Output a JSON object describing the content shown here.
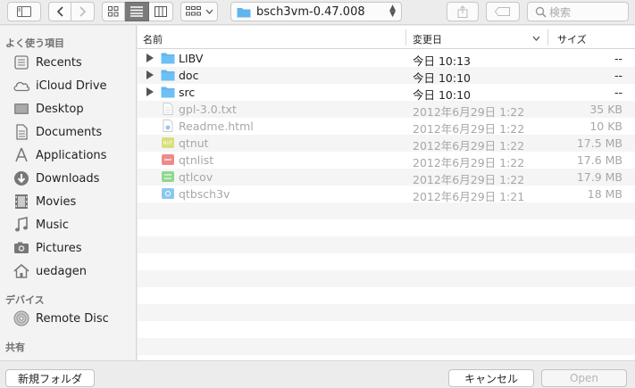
{
  "toolbar": {
    "path_label": "bsch3vm-0.47.008",
    "search_placeholder": "検索"
  },
  "sidebar": {
    "favorites_header": "よく使う項目",
    "favorites": [
      {
        "label": "Recents",
        "icon": "recents-icon"
      },
      {
        "label": "iCloud Drive",
        "icon": "cloud-icon"
      },
      {
        "label": "Desktop",
        "icon": "desktop-icon"
      },
      {
        "label": "Documents",
        "icon": "documents-icon"
      },
      {
        "label": "Applications",
        "icon": "applications-icon"
      },
      {
        "label": "Downloads",
        "icon": "downloads-icon"
      },
      {
        "label": "Movies",
        "icon": "movies-icon"
      },
      {
        "label": "Music",
        "icon": "music-icon"
      },
      {
        "label": "Pictures",
        "icon": "pictures-icon"
      },
      {
        "label": "uedagen",
        "icon": "home-icon"
      }
    ],
    "devices_header": "デバイス",
    "devices": [
      {
        "label": "Remote Disc",
        "icon": "disc-icon"
      }
    ],
    "shared_header": "共有"
  },
  "columns": {
    "name": "名前",
    "date": "変更日",
    "size": "サイズ"
  },
  "files": [
    {
      "name": "LIBV",
      "date": "今日 10:13",
      "size": "--",
      "kind": "folder",
      "enabled": true
    },
    {
      "name": "doc",
      "date": "今日 10:10",
      "size": "--",
      "kind": "folder",
      "enabled": true
    },
    {
      "name": "src",
      "date": "今日 10:10",
      "size": "--",
      "kind": "folder",
      "enabled": true
    },
    {
      "name": "gpl-3.0.txt",
      "date": "2012年6月29日 1:22",
      "size": "35 KB",
      "kind": "text",
      "enabled": false
    },
    {
      "name": "Readme.html",
      "date": "2012年6月29日 1:22",
      "size": "10 KB",
      "kind": "html",
      "enabled": false
    },
    {
      "name": "qtnut",
      "date": "2012年6月29日 1:22",
      "size": "17.5 MB",
      "kind": "app-yellow",
      "enabled": false
    },
    {
      "name": "qtnlist",
      "date": "2012年6月29日 1:22",
      "size": "17.6 MB",
      "kind": "app-red",
      "enabled": false
    },
    {
      "name": "qtlcov",
      "date": "2012年6月29日 1:22",
      "size": "17.9 MB",
      "kind": "app-green",
      "enabled": false
    },
    {
      "name": "qtbsch3v",
      "date": "2012年6月29日 1:21",
      "size": "18 MB",
      "kind": "app-blue",
      "enabled": false
    }
  ],
  "footer": {
    "new_folder": "新規フォルダ",
    "cancel": "キャンセル",
    "open": "Open"
  },
  "colors": {
    "folder": "#5fb6ee",
    "sidebar_bg": "#f3f3f3",
    "toolbar_bg": "#ececec"
  }
}
